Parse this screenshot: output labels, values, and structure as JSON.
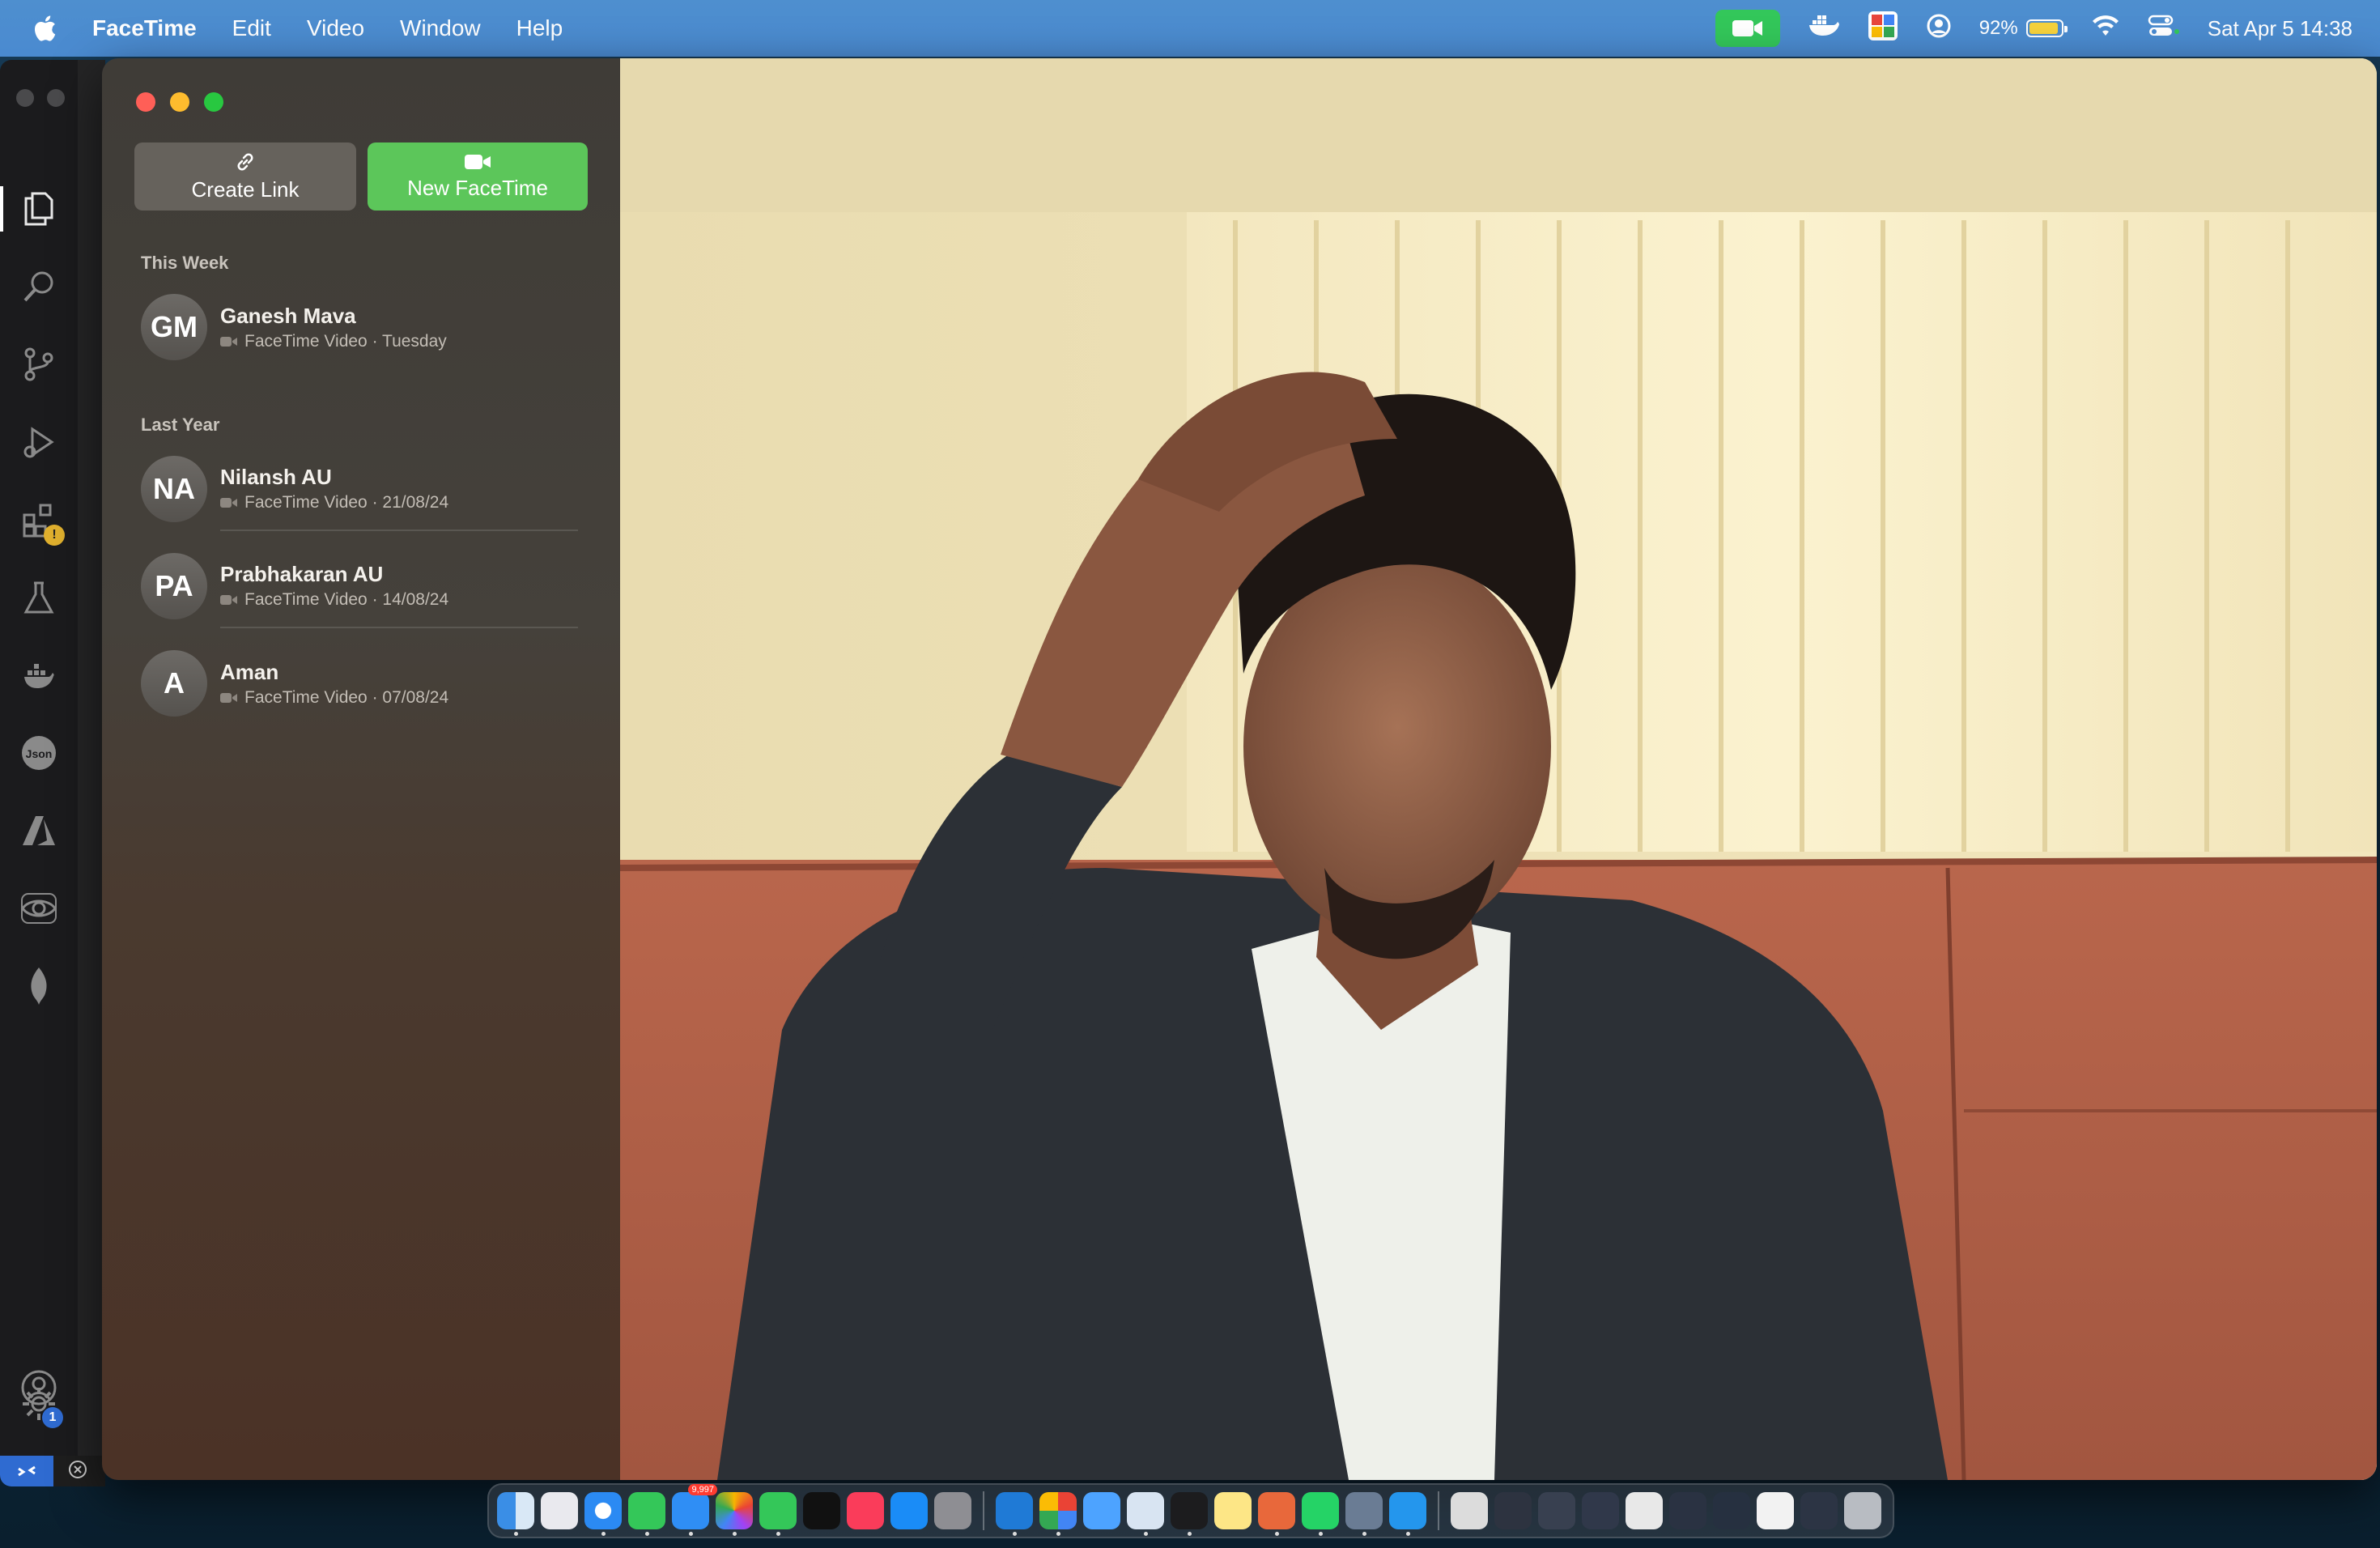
{
  "menubar": {
    "app_name": "FaceTime",
    "menus": [
      "Edit",
      "Video",
      "Window",
      "Help"
    ],
    "battery_percent": "92%",
    "datetime": "Sat Apr 5  14:38"
  },
  "sidebar": {
    "create_link_label": "Create Link",
    "new_facetime_label": "New FaceTime",
    "sections": [
      {
        "title": "This Week",
        "calls": [
          {
            "initials": "GM",
            "name": "Ganesh Mava",
            "detail": "FaceTime Video · Tuesday"
          }
        ]
      },
      {
        "title": "Last Year",
        "calls": [
          {
            "initials": "NA",
            "name": "Nilansh AU",
            "detail": "FaceTime Video · 21/08/24"
          },
          {
            "initials": "PA",
            "name": "Prabhakaran AU",
            "detail": "FaceTime Video · 14/08/24"
          },
          {
            "initials": "A",
            "name": "Aman",
            "detail": "FaceTime Video · 07/08/24"
          }
        ]
      }
    ]
  },
  "vscode": {
    "activity_icons": [
      "explorer-icon",
      "search-icon",
      "source-control-icon",
      "run-debug-icon",
      "extensions-icon",
      "testing-icon",
      "docker-icon",
      "json-icon",
      "azure-icon",
      "eye-icon",
      "mongodb-leaf-icon"
    ],
    "settings_badge": "1"
  },
  "dock": {
    "mail_badge": "9,997"
  },
  "colors": {
    "facetime_green": "#5cc65a",
    "menubar_blue": "#4a8ad0",
    "sidebar_bg": "#45413b"
  }
}
